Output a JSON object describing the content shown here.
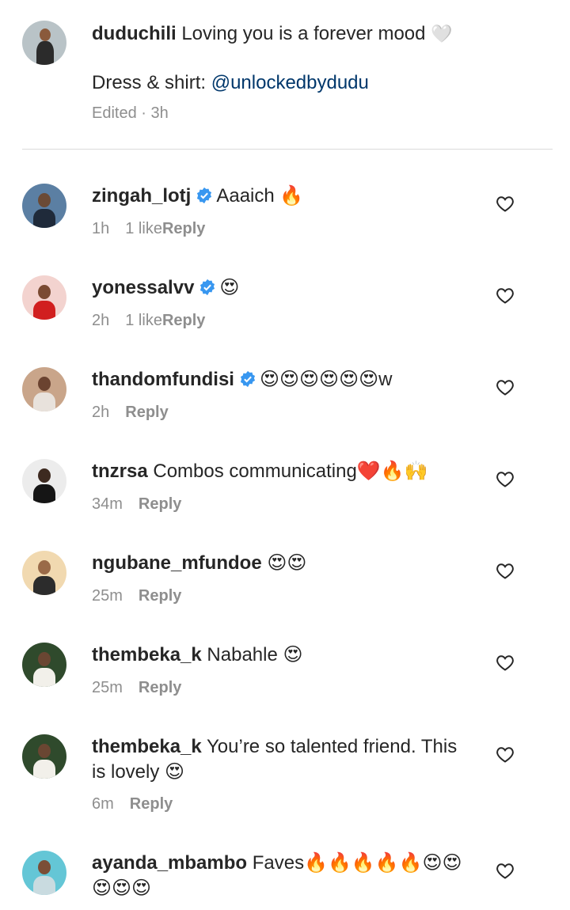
{
  "caption": {
    "username": "duduchili",
    "text": "Loving you is a forever mood",
    "text_emoji": "🤍",
    "line2_prefix": "Dress & shirt: ",
    "mention": "@unlockedbydudu",
    "meta": "Edited · 3h"
  },
  "comments": [
    {
      "username": "zingah_lotj",
      "verified": true,
      "text": "Aaaich 🔥",
      "time": "1h",
      "likes": "1 like",
      "reply": "Reply"
    },
    {
      "username": "yonessalvv",
      "verified": true,
      "text": "😍",
      "time": "2h",
      "likes": "1 like",
      "reply": "Reply"
    },
    {
      "username": "thandomfundisi",
      "verified": true,
      "text": "😍😍😍😍😍😍w",
      "time": "2h",
      "likes": "",
      "reply": "Reply"
    },
    {
      "username": "tnzrsa",
      "verified": false,
      "text": "Combos communicating❤️🔥🙌",
      "time": "34m",
      "likes": "",
      "reply": "Reply"
    },
    {
      "username": "ngubane_mfundoe",
      "verified": false,
      "text": "😍😍",
      "time": "25m",
      "likes": "",
      "reply": "Reply"
    },
    {
      "username": "thembeka_k",
      "verified": false,
      "text": "Nabahle 😍",
      "time": "25m",
      "likes": "",
      "reply": "Reply"
    },
    {
      "username": "thembeka_k",
      "verified": false,
      "text": "You’re so talented friend. This is lovely 😍",
      "time": "6m",
      "likes": "",
      "reply": "Reply"
    },
    {
      "username": "ayanda_mbambo",
      "verified": false,
      "text": "Faves🔥🔥🔥🔥🔥😍😍😍😍😍",
      "time": "",
      "likes": "",
      "reply": ""
    }
  ],
  "icons": {
    "like": "heart-outline-icon",
    "verified": "verified-badge-icon"
  },
  "colors": {
    "verified_blue": "#3897f0",
    "meta_gray": "#8e8e8e",
    "mention_blue": "#00376b"
  }
}
